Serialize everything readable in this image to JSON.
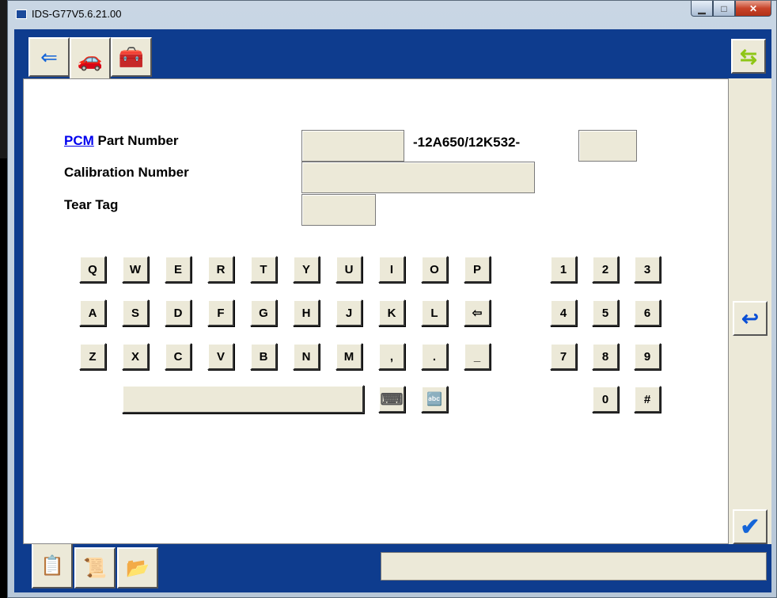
{
  "window": {
    "title": "IDS-G77V5.6.21.00"
  },
  "top_tabs": [
    {
      "name": "tab-connect",
      "icon": "⇐"
    },
    {
      "name": "tab-vehicle",
      "icon": "🚗"
    },
    {
      "name": "tab-toolbox",
      "icon": "🧰"
    }
  ],
  "side": {
    "swap_icon": "⇆",
    "back_icon": "↩",
    "tick_icon": "✔"
  },
  "form": {
    "pcm_link": "PCM",
    "pcm_label": "Part Number",
    "part_suffix": "-12A650/12K532-",
    "calibration_label": "Calibration Number",
    "tear_tag_label": "Tear Tag",
    "part_prefix_value": "",
    "part_suffix_value": "",
    "calibration_value": "",
    "tear_tag_value": ""
  },
  "keyboard": {
    "row1": [
      "Q",
      "W",
      "E",
      "R",
      "T",
      "Y",
      "U",
      "I",
      "O",
      "P"
    ],
    "row2": [
      "A",
      "S",
      "D",
      "F",
      "G",
      "H",
      "J",
      "K",
      "L",
      "⇦"
    ],
    "row3": [
      "Z",
      "X",
      "C",
      "V",
      "B",
      "N",
      "M",
      ",",
      ".",
      "_"
    ],
    "num1": [
      "1",
      "2",
      "3"
    ],
    "num2": [
      "4",
      "5",
      "6"
    ],
    "num3": [
      "7",
      "8",
      "9"
    ],
    "num4": [
      "0",
      "#"
    ],
    "keypad_icon": "⌨",
    "alpha_icon": "🔤"
  },
  "bottom_tabs": [
    {
      "name": "tab-datalog",
      "icon": "📋"
    },
    {
      "name": "tab-notes",
      "icon": "📜"
    },
    {
      "name": "tab-sessions",
      "icon": "📂"
    }
  ],
  "status": {
    "text": ""
  },
  "colors": {
    "client": "#0e3c8e",
    "panel": "#ffffff",
    "button": "#ece9d8",
    "link": "#0000ee"
  }
}
